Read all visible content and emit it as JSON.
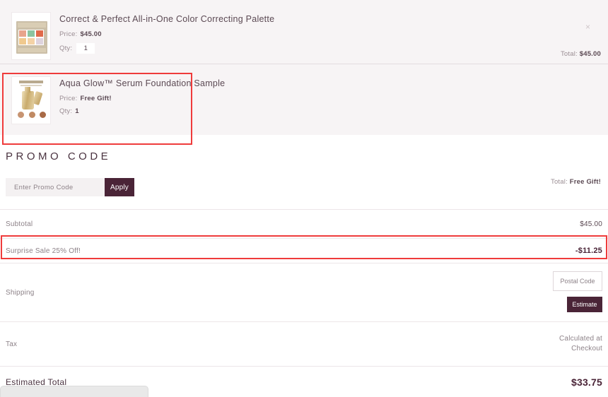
{
  "cart": {
    "items": [
      {
        "title": "Correct & Perfect All-in-One Color Correcting Palette",
        "price_label": "Price:",
        "price_value": "$45.00",
        "qty_label": "Qty:",
        "qty_value": "1",
        "total_label": "Total:",
        "total_value": "$45.00",
        "remove_icon": "×",
        "thumbnail": "color-correcting-palette-thumbnail"
      },
      {
        "title": "Aqua Glow™ Serum Foundation Sample",
        "price_label": "Price:",
        "price_value": "Free Gift!",
        "qty_label": "Qty:",
        "qty_value": "1",
        "total_label": "Total:",
        "total_value": "Free Gift!",
        "thumbnail": "serum-foundation-thumbnail"
      }
    ]
  },
  "promo": {
    "heading": "PROMO CODE",
    "input_placeholder": "Enter Promo Code",
    "input_value": "",
    "apply_label": "Apply"
  },
  "summary": {
    "subtotal": {
      "label": "Subtotal",
      "value": "$45.00"
    },
    "sale": {
      "label": "Surprise Sale 25% Off!",
      "value": "-$11.25"
    },
    "shipping": {
      "label": "Shipping",
      "postal_placeholder": "Postal Code",
      "postal_value": "",
      "estimate_label": "Estimate"
    },
    "tax": {
      "label": "Tax",
      "value_line1": "Calculated at",
      "value_line2": "Checkout"
    },
    "estimated_total": {
      "label": "Estimated Total",
      "value": "$33.75"
    }
  },
  "colors": {
    "accent": "#4a2437",
    "highlight": "#ef3b3b",
    "cart_bg": "#f7f4f5",
    "text": "#5b4953",
    "muted": "#8d8288"
  }
}
